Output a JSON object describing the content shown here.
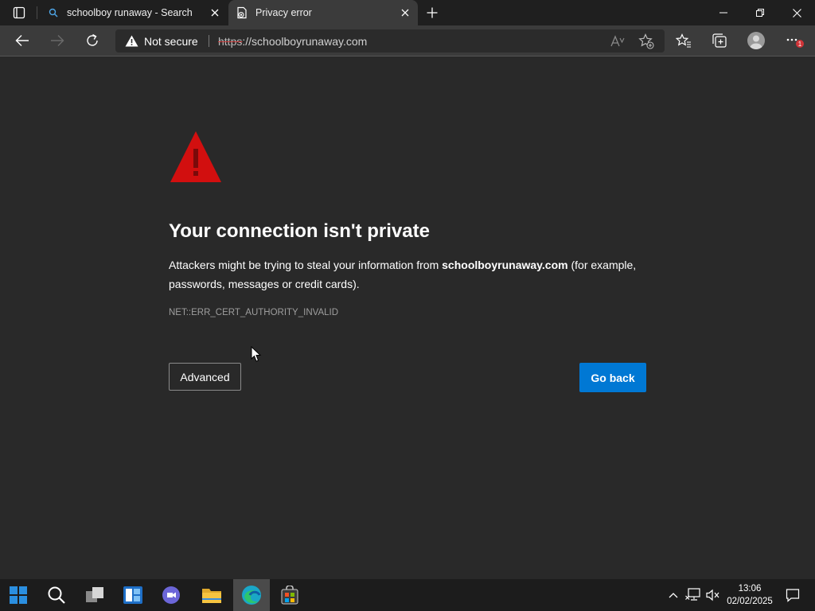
{
  "tabs": [
    {
      "title": "schoolboy runaway - Search",
      "icon": "search-icon"
    },
    {
      "title": "Privacy error",
      "icon": "broken-page-icon"
    }
  ],
  "toolbar": {
    "security_label": "Not secure",
    "url_scheme": "https",
    "url_rest": "://schoolboyrunaway.com",
    "notification_count": "1"
  },
  "error_page": {
    "heading": "Your connection isn't private",
    "desc_prefix": "Attackers might be trying to steal your information from ",
    "desc_domain": "schoolboyrunaway.com",
    "desc_suffix": " (for example, passwords, messages or credit cards).",
    "error_code": "NET::ERR_CERT_AUTHORITY_INVALID",
    "advanced_label": "Advanced",
    "back_label": "Go back",
    "warning_color": "#d20f0f",
    "accent_color": "#0078d4"
  },
  "taskbar": {
    "time": "13:06",
    "date": "02/02/2025",
    "apps": [
      "start-icon",
      "search-icon",
      "task-view-icon",
      "widgets-icon",
      "chat-icon",
      "file-explorer-icon",
      "edge-icon",
      "store-icon"
    ]
  }
}
